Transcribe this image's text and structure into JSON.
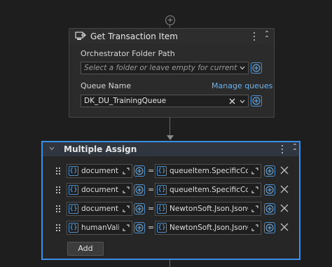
{
  "get_transaction": {
    "title": "Get Transaction Item",
    "folder_label": "Orchestrator Folder Path",
    "folder_placeholder": "Select a folder or leave empty for current worksp",
    "queue_label": "Queue Name",
    "manage_link": "Manage queues",
    "queue_value": "DK_DU_TrainingQueue"
  },
  "multiple_assign": {
    "title": "Multiple Assign",
    "rows": [
      {
        "left": "document",
        "right": "queueItem.SpecificCont"
      },
      {
        "left": "document",
        "right": "queueItem.SpecificCont"
      },
      {
        "left": "document",
        "right": "NewtonSoft.Json.JsonC"
      },
      {
        "left": "humanVali",
        "right": "NewtonSoft.Json.JsonC"
      }
    ],
    "add_label": "Add"
  },
  "icons": {
    "connector": "add-connector-icon",
    "activity": "transaction-item-icon",
    "kebab": "more-options-icon",
    "collapse": "collapse-icon",
    "expression": "expression-braces-icon",
    "expand": "expand-icon",
    "plus": "plus-circle-icon",
    "clear": "clear-x-icon",
    "dropdown": "chevron-down-icon",
    "grip": "drag-handle-icon"
  },
  "colors": {
    "accent": "#3a8ee6",
    "link": "#6cb3f0",
    "background": "#1e1e1e"
  }
}
